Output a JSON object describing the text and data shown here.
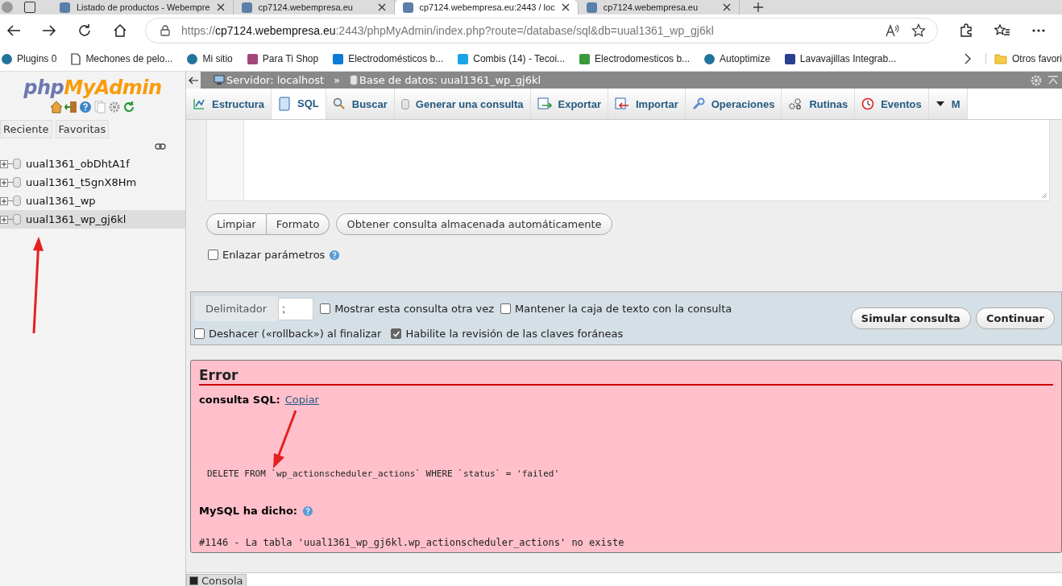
{
  "browser": {
    "tabs": [
      {
        "title": "Listado de productos - Webempre",
        "selected": false
      },
      {
        "title": "cp7124.webempresa.eu",
        "selected": false
      },
      {
        "title": "cp7124.webempresa.eu:2443 / loc",
        "selected": true
      },
      {
        "title": "cp7124.webempresa.eu",
        "selected": false
      }
    ],
    "url": {
      "scheme": "https://",
      "host": "cp7124.webempresa.eu",
      "rest": ":2443/phpMyAdmin/index.php?route=/database/sql&db=uual1361_wp_gj6kl"
    },
    "bookmarks": [
      {
        "label": "Plugins 0",
        "kind": "wp"
      },
      {
        "label": "Mechones de pelo...",
        "kind": "page"
      },
      {
        "label": "Mi sitio",
        "kind": "wp"
      },
      {
        "label": "Para Ti Shop",
        "kind": "plant"
      },
      {
        "label": "Electrodomésticos b...",
        "kind": "house"
      },
      {
        "label": "Combis (14) - Tecoi...",
        "kind": "am"
      },
      {
        "label": "Electrodomesticos b...",
        "kind": "e"
      },
      {
        "label": "Autoptimize",
        "kind": "wp"
      },
      {
        "label": "Lavavajillas Integrab...",
        "kind": "img"
      }
    ],
    "other_bookmarks": "Otros favori"
  },
  "sidebar": {
    "logo": {
      "part1": "php",
      "part2": "MyAdmin"
    },
    "tabs": [
      "Reciente",
      "Favoritas"
    ],
    "databases": [
      {
        "name": "uual1361_obDhtA1f",
        "selected": false
      },
      {
        "name": "uual1361_t5gnX8Hm",
        "selected": false
      },
      {
        "name": "uual1361_wp",
        "selected": false
      },
      {
        "name": "uual1361_wp_gj6kl",
        "selected": true
      }
    ]
  },
  "breadcrumb": {
    "server": "Servidor: localhost",
    "separator": "»",
    "database": "Base de datos: uual1361_wp_gj6kl"
  },
  "tabs": [
    {
      "label": "Estructura",
      "selected": false
    },
    {
      "label": "SQL",
      "selected": true
    },
    {
      "label": "Buscar",
      "selected": false
    },
    {
      "label": "Generar una consulta",
      "selected": false
    },
    {
      "label": "Exportar",
      "selected": false
    },
    {
      "label": "Importar",
      "selected": false
    },
    {
      "label": "Operaciones",
      "selected": false
    },
    {
      "label": "Rutinas",
      "selected": false
    },
    {
      "label": "Eventos",
      "selected": false
    },
    {
      "label": "M",
      "selected": false
    }
  ],
  "query_buttons": [
    "Limpiar",
    "Formato"
  ],
  "stored_query_button": "Obtener consulta almacenada automáticamente",
  "bind_parameters": {
    "label": "Enlazar parámetros",
    "checked": false
  },
  "options": {
    "delimiter_label": "Delimitador",
    "delimiter_value": ";",
    "checks": [
      {
        "label": "Mostrar esta consulta otra vez",
        "checked": false
      },
      {
        "label": "Mantener la caja de texto con la consulta",
        "checked": false
      },
      {
        "label": "Deshacer («rollback») al finalizar",
        "checked": false
      },
      {
        "label": "Habilite la revisión de las claves foráneas",
        "checked": true
      }
    ],
    "buttons": [
      "Simular consulta",
      "Continuar"
    ]
  },
  "error": {
    "title": "Error",
    "sql_label": "consulta SQL:",
    "copy_link": "Copiar",
    "query": "DELETE FROM `wp_actionscheduler_actions` WHERE `status` = 'failed'",
    "mysql_label": "MySQL ha dicho:",
    "message": "#1146 - La tabla 'uual1361_wp_gj6kl.wp_actionscheduler_actions' no existe"
  },
  "console": "Consola"
}
